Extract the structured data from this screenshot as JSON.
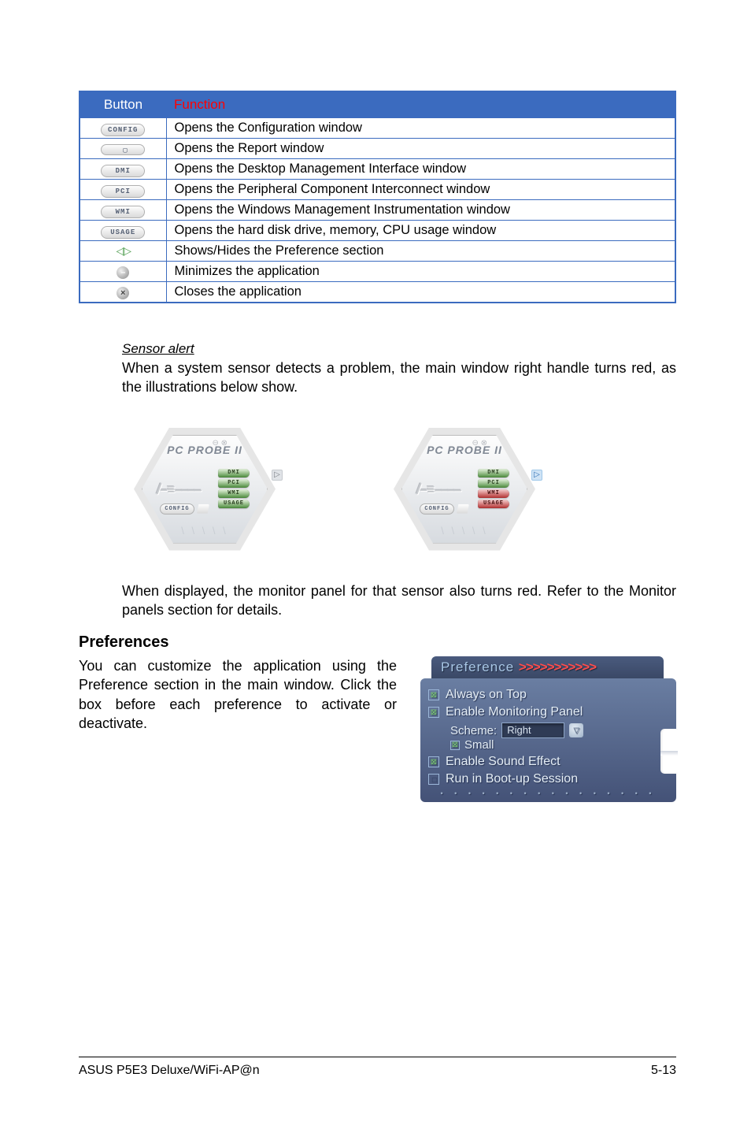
{
  "tableHeader": {
    "button": "Button",
    "function": "Function"
  },
  "tableRows": [
    {
      "btnLabel": "CONFIG",
      "btnKind": "text",
      "func": "Opens the Configuration window"
    },
    {
      "btnLabel": "",
      "btnKind": "blank",
      "func": "Opens the Report window"
    },
    {
      "btnLabel": "DMI",
      "btnKind": "text",
      "func": "Opens the Desktop Management Interface window"
    },
    {
      "btnLabel": "PCI",
      "btnKind": "text",
      "func": "Opens the Peripheral Component Interconnect window"
    },
    {
      "btnLabel": "WMI",
      "btnKind": "text",
      "func": "Opens the Windows Management Instrumentation window"
    },
    {
      "btnLabel": "USAGE",
      "btnKind": "text",
      "func": "Opens the hard disk drive, memory, CPU usage window"
    },
    {
      "btnLabel": "◁▷",
      "btnKind": "arrows",
      "func": "Shows/Hides the Preference section"
    },
    {
      "btnLabel": "–",
      "btnKind": "circle-minus",
      "func": "Minimizes the application"
    },
    {
      "btnLabel": "×",
      "btnKind": "circle-cross",
      "func": "Closes the application"
    }
  ],
  "sensor": {
    "title": "Sensor alert",
    "para": "When a system sensor detects a problem, the main window right handle turns red, as the illustrations below show."
  },
  "hex": {
    "title": "PC PROBE II",
    "tabs": [
      "DMI",
      "PCI",
      "WMI",
      "USAGE"
    ],
    "config": "CONFIG",
    "topdots": "⊖ ⊗",
    "hatch": "\\ \\ \\ \\ \\",
    "asus": "/–≡⎯⎯⎯⎯"
  },
  "afterHex": "When displayed, the monitor panel for that sensor also turns red. Refer to the Monitor panels section for details.",
  "prefs": {
    "heading": "Preferences",
    "left": "You can customize the application using the Preference section in the main window. Click the box before each preference to activate or deactivate.",
    "tab": "Preference ",
    "chevrons": ">>>>>>>>>>>",
    "items": {
      "always": "Always on Top",
      "enableMon": "Enable Monitoring Panel",
      "schemeLabel": "Scheme:",
      "schemeValue": "Right",
      "small": "Small",
      "sound": "Enable Sound Effect",
      "boot": "Run in Boot-up Session"
    }
  },
  "footer": {
    "left": "ASUS P5E3 Deluxe/WiFi-AP@n",
    "right": "5-13"
  }
}
